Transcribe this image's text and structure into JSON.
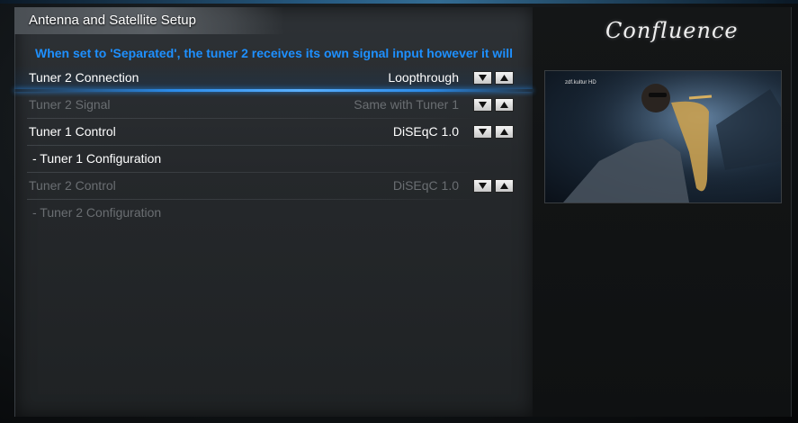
{
  "header": {
    "title": "Antenna and Satellite Setup"
  },
  "hint": "When set to 'Separated', the tuner 2 receives its own signal input however it will",
  "settings": [
    {
      "label": "Tuner 2 Connection",
      "value": "Loopthrough"
    },
    {
      "label": "Tuner 2 Signal",
      "value": "Same with Tuner 1"
    },
    {
      "label": "Tuner 1 Control",
      "value": "DiSEqC 1.0"
    },
    {
      "label": "- Tuner 1 Configuration",
      "value": ""
    },
    {
      "label": "Tuner 2 Control",
      "value": "DiSEqC 1.0"
    },
    {
      "label": "- Tuner 2 Configuration",
      "value": ""
    }
  ],
  "branding": {
    "logo_text": "Confluence"
  },
  "preview": {
    "channel_logo": "zdf.kultur HD"
  },
  "icons": {
    "down": "arrow-down-icon",
    "up": "arrow-up-icon"
  },
  "colors": {
    "hint_text": "#1e90ff",
    "focus_accent": "#2a8ae8",
    "disabled_text": "#6a6e72"
  }
}
